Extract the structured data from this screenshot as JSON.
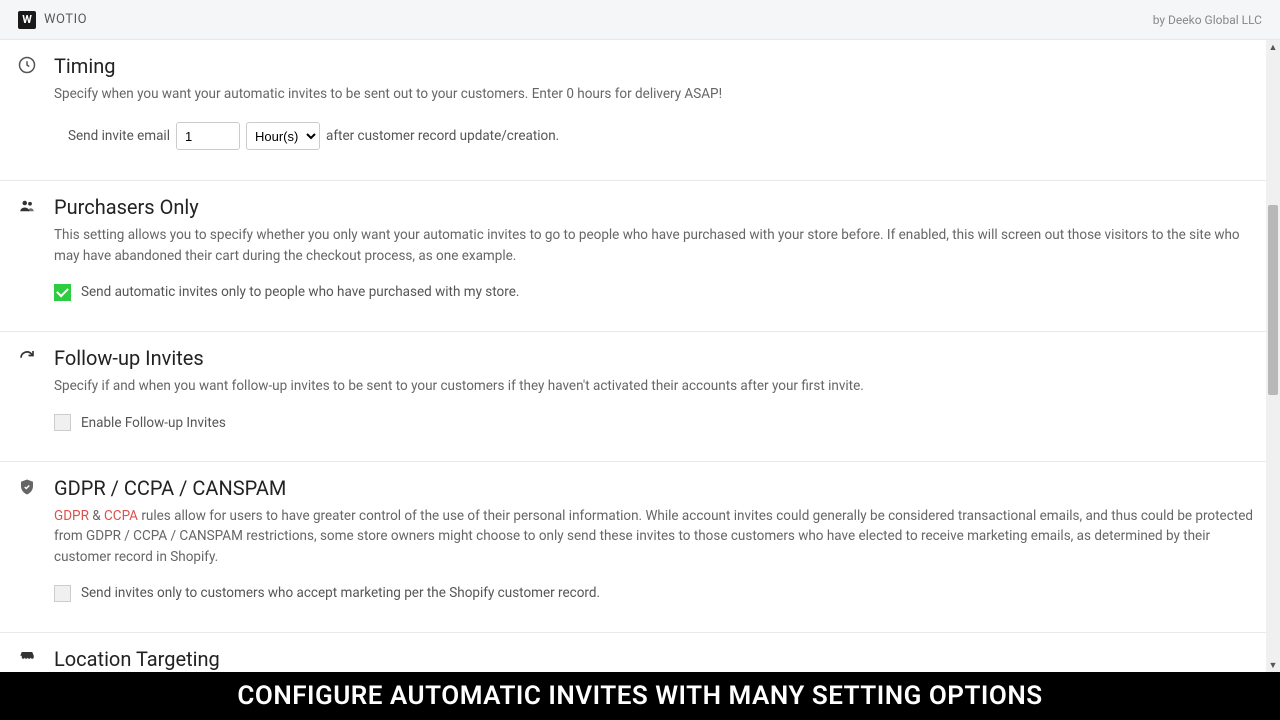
{
  "header": {
    "logo_letter": "W",
    "app_name": "WOTIO",
    "byline": "by Deeko Global LLC"
  },
  "sections": {
    "timing": {
      "title": "Timing",
      "desc": "Specify when you want your automatic invites to be sent out to your customers. Enter 0 hours for delivery ASAP!",
      "label_before": "Send invite email",
      "value": "1",
      "unit_selected": "Hour(s)",
      "label_after": "after customer record update/creation."
    },
    "purchasers": {
      "title": "Purchasers Only",
      "desc": "This setting allows you to specify whether you only want your automatic invites to go to people who have purchased with your store before. If enabled, this will screen out those visitors to the site who may have abandoned their cart during the checkout process, as one example.",
      "checkbox_label": "Send automatic invites only to people who have purchased with my store.",
      "checked": true
    },
    "followup": {
      "title": "Follow-up Invites",
      "desc": "Specify if and when you want follow-up invites to be sent to your customers if they haven't activated their accounts after your first invite.",
      "checkbox_label": "Enable Follow-up Invites",
      "checked": false
    },
    "gdpr": {
      "title": "GDPR / CCPA / CANSPAM",
      "link1": "GDPR",
      "amp": " & ",
      "link2": "CCPA",
      "desc_rest": " rules allow for users to have greater control of the use of their personal information. While account invites could generally be considered transactional emails, and thus could be protected from GDPR / CCPA / CANSPAM restrictions, some store owners might choose to only send these invites to those customers who have elected to receive marketing emails, as determined by their customer record in Shopify.",
      "checkbox_label": "Send invites only to customers who accept marketing per the Shopify customer record.",
      "checked": false
    },
    "location": {
      "title": "Location Targeting"
    }
  },
  "banner": "CONFIGURE AUTOMATIC INVITES WITH MANY SETTING OPTIONS"
}
